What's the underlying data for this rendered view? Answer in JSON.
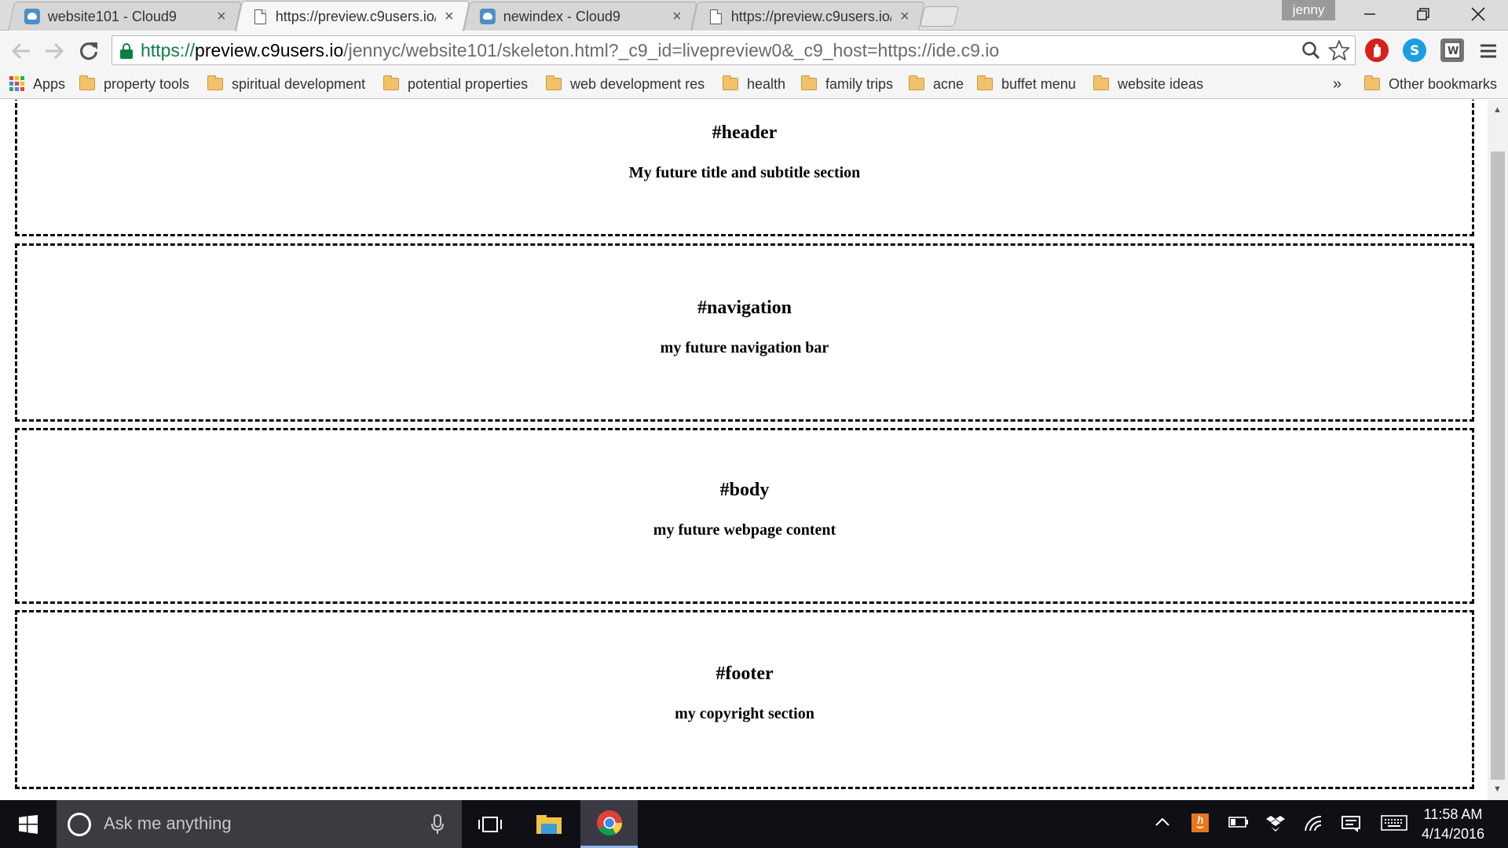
{
  "browser": {
    "tabs": [
      {
        "title": "website101 - Cloud9",
        "favicon": "cloud9-icon",
        "active": false
      },
      {
        "title": "https://preview.c9users.io/",
        "favicon": "page-icon",
        "active": true
      },
      {
        "title": "newindex - Cloud9",
        "favicon": "cloud9-icon",
        "active": false
      },
      {
        "title": "https://preview.c9users.io/",
        "favicon": "page-icon",
        "active": false
      }
    ],
    "close_glyph": "×",
    "profile_name": "jenny",
    "address": {
      "scheme": "https://",
      "host": "preview.c9users.io",
      "path": "/jennyc/website101/skeleton.html?_c9_id=livepreview0&_c9_host=https://ide.c9.io"
    },
    "bookmarks": {
      "apps_label": "Apps",
      "items": [
        "property tools",
        "spiritual development",
        "potential properties",
        "web development res",
        "health",
        "family trips",
        "acne",
        "buffet menu",
        "website ideas"
      ],
      "overflow_glyph": "»",
      "other_label": "Other bookmarks"
    }
  },
  "page": {
    "sections": [
      {
        "heading": "#header",
        "text": "My future title and subtitle section"
      },
      {
        "heading": "#navigation",
        "text": "my future navigation bar"
      },
      {
        "heading": "#body",
        "text": "my future webpage content"
      },
      {
        "heading": "#footer",
        "text": "my copyright section"
      }
    ]
  },
  "taskbar": {
    "search_placeholder": "Ask me anything",
    "time": "11:58 AM",
    "date": "4/14/2016"
  },
  "colors": {
    "secure_green": "#0b8043",
    "taskbar_bg": "#0f0f16",
    "tab_bg": "#d6d6d6",
    "active_tab_bg": "#f7f7f7"
  }
}
